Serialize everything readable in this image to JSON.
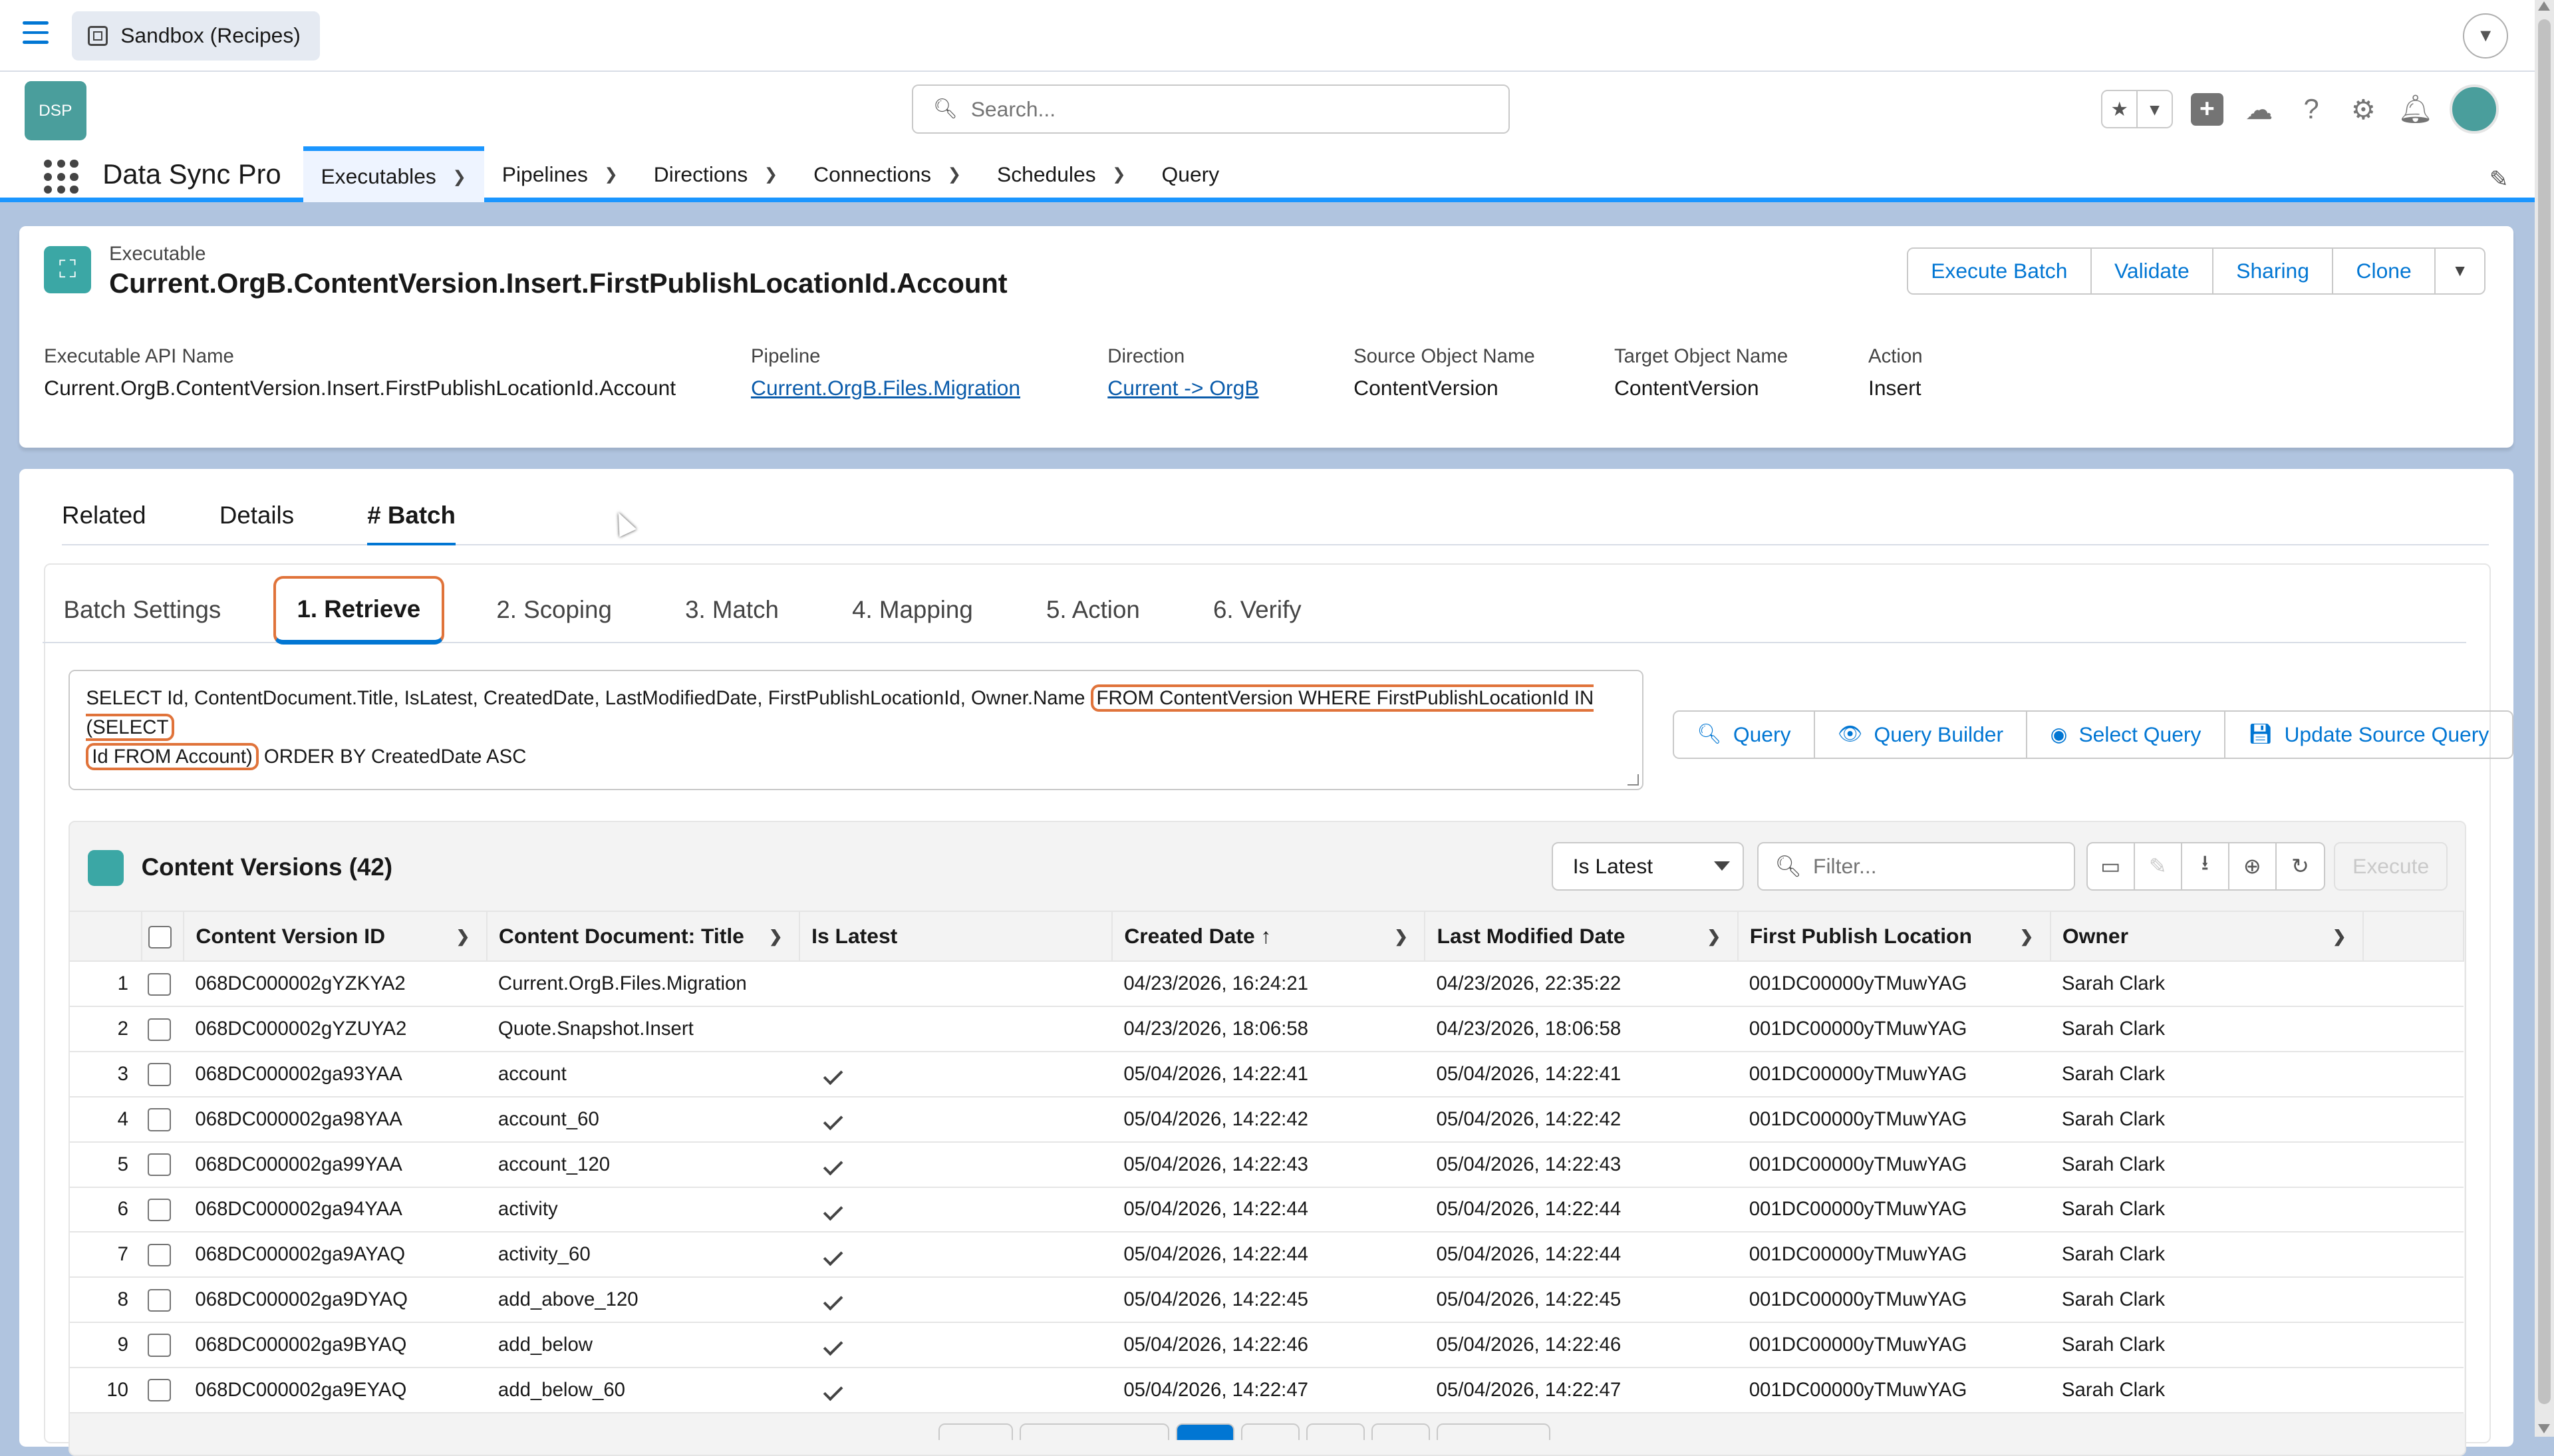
{
  "topbar": {
    "sandbox_label": "Sandbox (Recipes)"
  },
  "search": {
    "placeholder": "Search..."
  },
  "app": {
    "name": "Data Sync Pro",
    "logo_text": "DSP"
  },
  "nav": [
    {
      "label": "Executables"
    },
    {
      "label": "Pipelines"
    },
    {
      "label": "Directions"
    },
    {
      "label": "Connections"
    },
    {
      "label": "Schedules"
    },
    {
      "label": "Query"
    }
  ],
  "record": {
    "type_label": "Executable",
    "title": "Current.OrgB.ContentVersion.Insert.FirstPublishLocationId.Account",
    "actions": [
      "Execute Batch",
      "Validate",
      "Sharing",
      "Clone"
    ],
    "fields": {
      "api_name_label": "Executable API Name",
      "api_name": "Current.OrgB.ContentVersion.Insert.FirstPublishLocationId.Account",
      "pipeline_label": "Pipeline",
      "pipeline": "Current.OrgB.Files.Migration",
      "direction_label": "Direction",
      "direction": "Current -> OrgB",
      "source_label": "Source Object Name",
      "source": "ContentVersion",
      "target_label": "Target Object Name",
      "target": "ContentVersion",
      "action_label": "Action",
      "action": "Insert"
    }
  },
  "tabs": [
    "Related",
    "Details",
    "# Batch"
  ],
  "subtabs": [
    "Batch Settings",
    "1. Retrieve",
    "2. Scoping",
    "3. Match",
    "4. Mapping",
    "5. Action",
    "6. Verify"
  ],
  "query": {
    "part1": "SELECT Id, ContentDocument.Title, IsLatest, CreatedDate, LastModifiedDate, FirstPublishLocationId, Owner.Name ",
    "part2": "FROM ContentVersion WHERE FirstPublishLocationId IN (SELECT",
    "part3": "Id FROM Account)",
    "part4": " ORDER BY CreatedDate ASC",
    "buttons": [
      "Query",
      "Query Builder",
      "Select Query",
      "Update Source Query"
    ]
  },
  "table": {
    "title": "Content Versions (42)",
    "filter_select": "Is Latest",
    "filter_placeholder": "Filter...",
    "execute_label": "Execute",
    "columns": [
      "Content Version ID",
      "Content Document: Title",
      "Is Latest",
      "Created Date",
      "Last Modified Date",
      "First Publish Location",
      "Owner"
    ],
    "sort_indicator": "↑",
    "rows": [
      {
        "n": "1",
        "id": "068DC000002gYZKYA2",
        "title": "Current.OrgB.Files.Migration",
        "latest": false,
        "created": "04/23/2026, 16:24:21",
        "modified": "04/23/2026, 22:35:22",
        "loc": "001DC00000yTMuwYAG",
        "owner": "Sarah Clark"
      },
      {
        "n": "2",
        "id": "068DC000002gYZUYA2",
        "title": "Quote.Snapshot.Insert",
        "latest": false,
        "created": "04/23/2026, 18:06:58",
        "modified": "04/23/2026, 18:06:58",
        "loc": "001DC00000yTMuwYAG",
        "owner": "Sarah Clark"
      },
      {
        "n": "3",
        "id": "068DC000002ga93YAA",
        "title": "account",
        "latest": true,
        "created": "05/04/2026, 14:22:41",
        "modified": "05/04/2026, 14:22:41",
        "loc": "001DC00000yTMuwYAG",
        "owner": "Sarah Clark"
      },
      {
        "n": "4",
        "id": "068DC000002ga98YAA",
        "title": "account_60",
        "latest": true,
        "created": "05/04/2026, 14:22:42",
        "modified": "05/04/2026, 14:22:42",
        "loc": "001DC00000yTMuwYAG",
        "owner": "Sarah Clark"
      },
      {
        "n": "5",
        "id": "068DC000002ga99YAA",
        "title": "account_120",
        "latest": true,
        "created": "05/04/2026, 14:22:43",
        "modified": "05/04/2026, 14:22:43",
        "loc": "001DC00000yTMuwYAG",
        "owner": "Sarah Clark"
      },
      {
        "n": "6",
        "id": "068DC000002ga94YAA",
        "title": "activity",
        "latest": true,
        "created": "05/04/2026, 14:22:44",
        "modified": "05/04/2026, 14:22:44",
        "loc": "001DC00000yTMuwYAG",
        "owner": "Sarah Clark"
      },
      {
        "n": "7",
        "id": "068DC000002ga9AYAQ",
        "title": "activity_60",
        "latest": true,
        "created": "05/04/2026, 14:22:44",
        "modified": "05/04/2026, 14:22:44",
        "loc": "001DC00000yTMuwYAG",
        "owner": "Sarah Clark"
      },
      {
        "n": "8",
        "id": "068DC000002ga9DYAQ",
        "title": "add_above_120",
        "latest": true,
        "created": "05/04/2026, 14:22:45",
        "modified": "05/04/2026, 14:22:45",
        "loc": "001DC00000yTMuwYAG",
        "owner": "Sarah Clark"
      },
      {
        "n": "9",
        "id": "068DC000002ga9BYAQ",
        "title": "add_below",
        "latest": true,
        "created": "05/04/2026, 14:22:46",
        "modified": "05/04/2026, 14:22:46",
        "loc": "001DC00000yTMuwYAG",
        "owner": "Sarah Clark"
      },
      {
        "n": "10",
        "id": "068DC000002ga9EYAQ",
        "title": "add_below_60",
        "latest": true,
        "created": "05/04/2026, 14:22:47",
        "modified": "05/04/2026, 14:22:47",
        "loc": "001DC00000yTMuwYAG",
        "owner": "Sarah Clark"
      }
    ]
  }
}
